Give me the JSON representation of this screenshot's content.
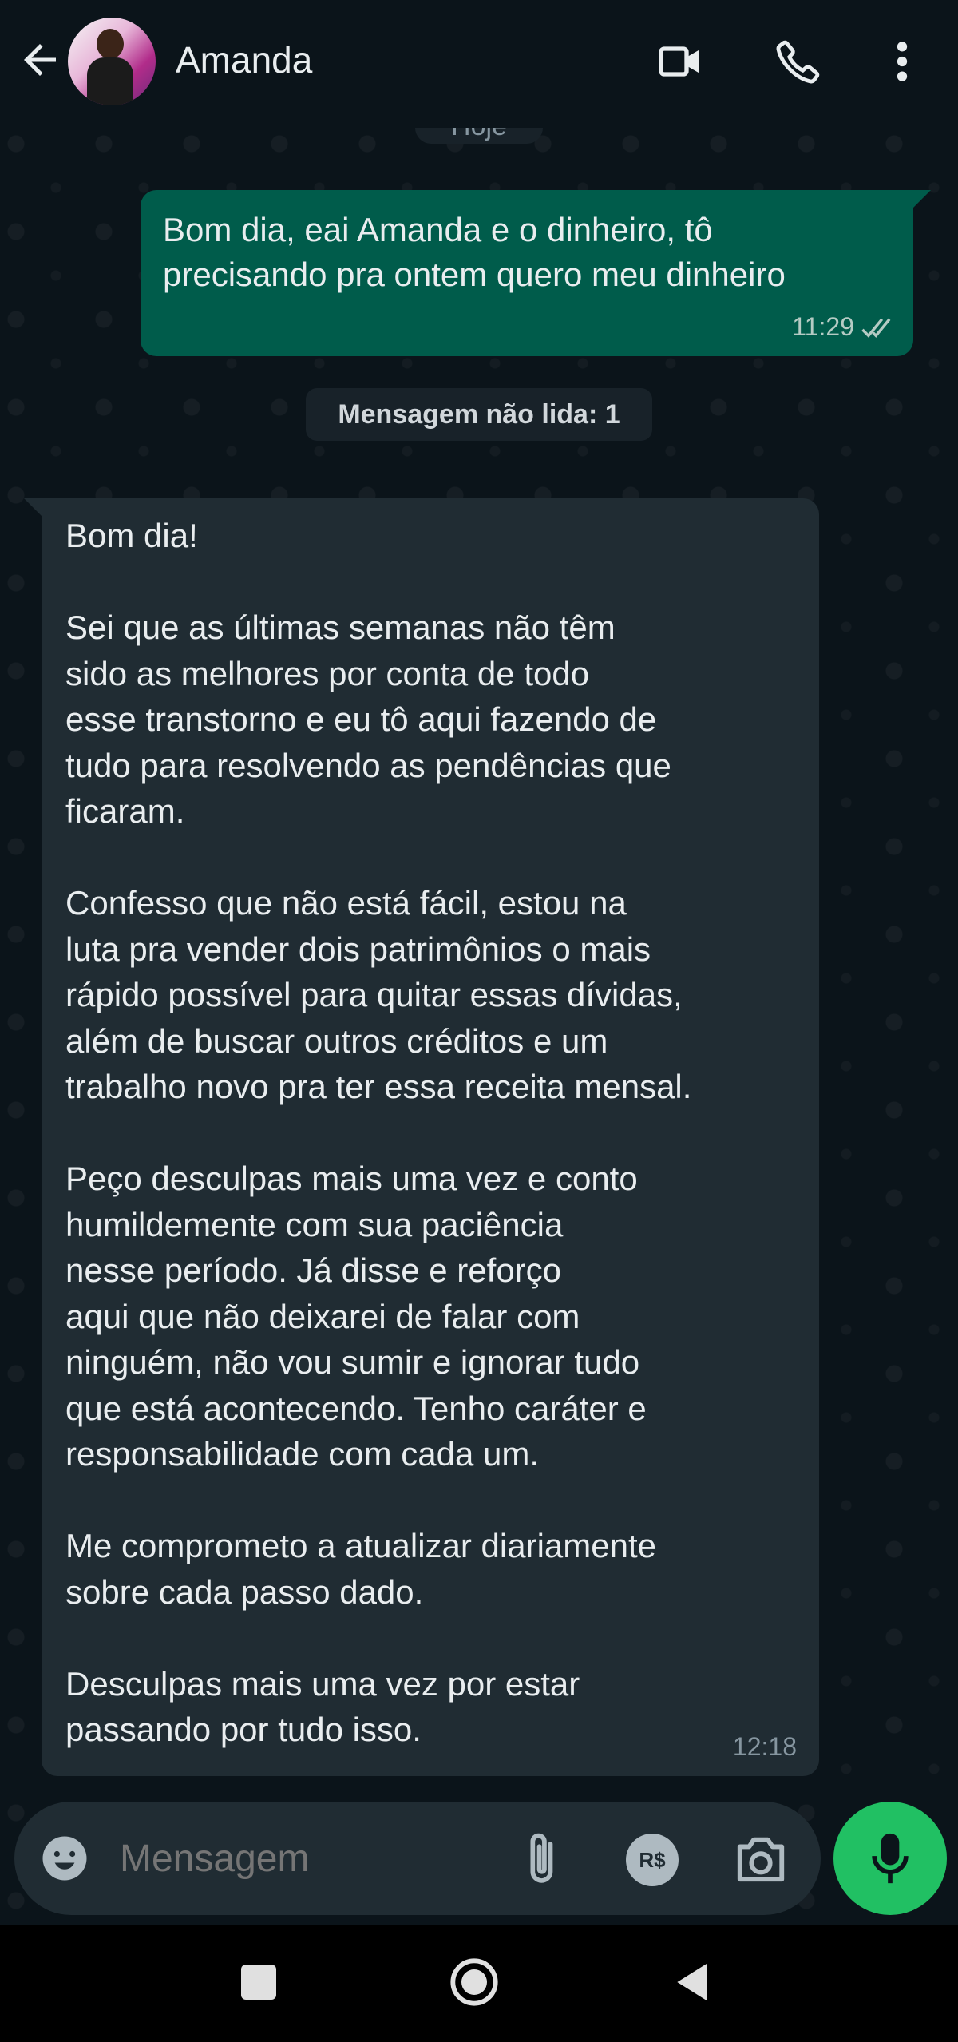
{
  "header": {
    "contact_name": "Amanda",
    "back_icon": "arrow-left-icon",
    "video_icon": "videocam-icon",
    "call_icon": "phone-icon",
    "menu_icon": "more-vert-icon"
  },
  "day_chip": "Hoje",
  "messages": [
    {
      "direction": "outgoing",
      "text": "Bom dia, eai Amanda e o dinheiro, tô\nprecisando pra ontem quero meu dinheiro",
      "time": "11:29",
      "status_icon": "double-check-icon"
    },
    {
      "direction": "incoming",
      "text": "Bom dia!\n\nSei que as últimas semanas não têm\nsido as melhores por conta de todo\nesse transtorno e eu tô aqui fazendo de\ntudo para resolvendo as pendências que\nficaram.\n\nConfesso que não está fácil, estou na\nluta pra vender dois patrimônios o mais\nrápido possível para quitar essas dívidas,\nalém de buscar outros créditos e um\ntrabalho novo pra ter essa receita mensal.\n\nPeço desculpas mais uma vez e conto\nhumildemente com sua paciência\nnesse período. Já disse e reforço\naqui que não deixarei de falar com\nninguém, não vou sumir e ignorar tudo\nque está acontecendo. Tenho caráter e\nresponsabilidade com cada um.\n\nMe comprometo a atualizar diariamente\nsobre cada passo dado.\n\nDesculpas mais uma vez por estar\npassando por tudo isso.",
      "time": "12:18"
    }
  ],
  "unread_banner": "Mensagem não lida: 1",
  "composer": {
    "placeholder": "Mensagem",
    "emoji_icon": "emoji-icon",
    "attach_icon": "paperclip-icon",
    "payment_label": "R$",
    "camera_icon": "camera-icon",
    "mic_icon": "microphone-icon"
  },
  "colors": {
    "background": "#0b141a",
    "outgoing_bubble": "#005c4b",
    "incoming_bubble": "#202c33",
    "accent_green": "#21c063"
  }
}
